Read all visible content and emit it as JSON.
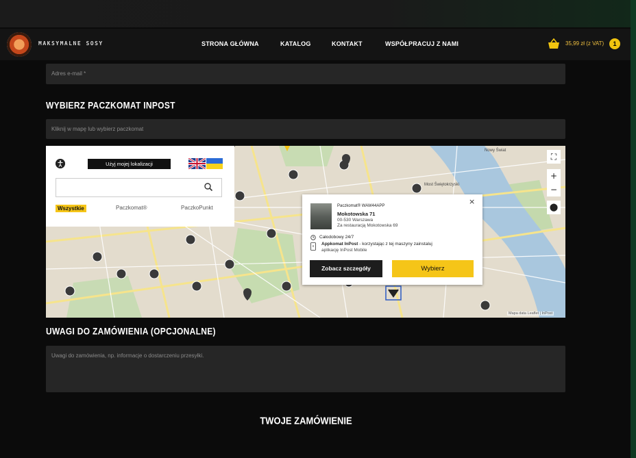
{
  "header": {
    "logo_text": "MAKSYMALNE SOSY",
    "nav": [
      "STRONA GŁÓWNA",
      "KATALOG",
      "KONTAKT",
      "WSPÓŁPRACUJ Z NAMI"
    ],
    "cart_total": "35,99 zł (z VAT)",
    "cart_count": "1",
    "accent_color": "#f5c518"
  },
  "form": {
    "email_placeholder": "Adres e-mail *",
    "paczkomat_heading": "WYBIERZ PACZKOMAT INPOST",
    "paczkomat_placeholder": "Kliknij w mapę lub wybierz paczkomat",
    "notes_heading": "UWAGI DO ZAMÓWIENIA (OPCJONALNE)",
    "notes_placeholder": "Uwagi do zamówienia, np. informacje o dostarczeniu przesyłki.",
    "order_heading": "TWOJE ZAMÓWIENIE"
  },
  "map": {
    "use_location_label": "Użyj mojej lokalizacji",
    "search_value": "",
    "filters": [
      "Wszystkie",
      "Paczkomat®",
      "PaczkoPunkt"
    ],
    "labels": {
      "zoom_in": "+",
      "zoom_out": "−",
      "attribution": "Mapa data  Leaflet | InPost",
      "district_top": "Nowy Świat",
      "district_right": "Most Świętokrzyski"
    },
    "popup": {
      "type": "Paczkomat® WAW44APP",
      "name": "Mokotowska 71",
      "address": "00-530 Warszawa",
      "location": "Za restauracją Mokotowska 69",
      "hours": "Całodobowy 24/7",
      "app_title": "Appkomat InPost",
      "app_desc_1": " - korzystając z tej maszyny zainstaluj",
      "app_desc_2": "aplikację InPost Mobile",
      "details_button": "Zobacz szczegóły",
      "choose_button": "Wybierz"
    }
  }
}
